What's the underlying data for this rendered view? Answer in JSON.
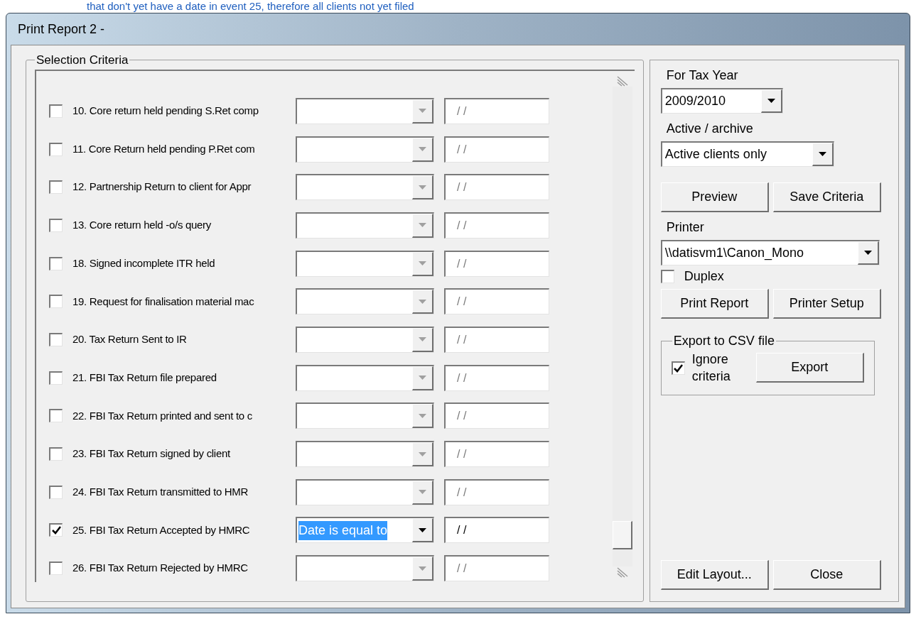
{
  "caption_above": "that don't yet have a date in event 25, therefore all clients not yet filed",
  "window": {
    "title": "Print Report 2 -"
  },
  "selection_criteria": {
    "title": "Selection Criteria",
    "rows": [
      {
        "label": "10. Core return held pending S.Ret comp",
        "checked": false,
        "condition": {
          "enabled": false
        },
        "date": "/ /"
      },
      {
        "label": "11. Core Return held pending P.Ret com",
        "checked": false,
        "condition": {
          "enabled": false
        },
        "date": "/ /"
      },
      {
        "label": "12. Partnership Return to client for Appr",
        "checked": false,
        "condition": {
          "enabled": false
        },
        "date": "/ /"
      },
      {
        "label": "13. Core return held -o/s query",
        "checked": false,
        "condition": {
          "enabled": false
        },
        "date": "/ /"
      },
      {
        "label": "18. Signed incomplete ITR held",
        "checked": false,
        "condition": {
          "enabled": false
        },
        "date": "/ /"
      },
      {
        "label": "19. Request for finalisation material mac",
        "checked": false,
        "condition": {
          "enabled": false
        },
        "date": "/ /"
      },
      {
        "label": "20. Tax Return Sent to IR",
        "checked": false,
        "condition": {
          "enabled": false
        },
        "date": "/ /"
      },
      {
        "label": "21. FBI Tax Return file prepared",
        "checked": false,
        "condition": {
          "enabled": false
        },
        "date": "/ /"
      },
      {
        "label": "22. FBI Tax Return printed and sent to c",
        "checked": false,
        "condition": {
          "enabled": false
        },
        "date": "/ /"
      },
      {
        "label": "23. FBI Tax Return signed by client",
        "checked": false,
        "condition": {
          "enabled": false
        },
        "date": "/ /"
      },
      {
        "label": "24. FBI Tax Return transmitted to HMR",
        "checked": false,
        "condition": {
          "enabled": false
        },
        "date": "/ /"
      },
      {
        "label": "25. FBI Tax Return Accepted by HMRC",
        "checked": true,
        "condition": {
          "value": "Date is equal to",
          "enabled": true
        },
        "date": "/ /"
      },
      {
        "label": "26. FBI Tax Return Rejected by HMRC",
        "checked": false,
        "condition": {
          "enabled": false
        },
        "date": "/ /"
      }
    ]
  },
  "tax_year": {
    "label": "For Tax Year",
    "value": "2009/2010"
  },
  "active_archive": {
    "label": "Active / archive",
    "value": "Active clients only"
  },
  "buttons_top": [
    "Preview",
    "Save Criteria"
  ],
  "printer": {
    "label": "Printer",
    "value": "\\\\datisvm1\\Canon_Mono"
  },
  "duplex": {
    "label": "Duplex",
    "checked": false
  },
  "buttons_print": [
    "Print Report",
    "Printer Setup"
  ],
  "export": {
    "title": "Export to CSV file",
    "ignore_label": "Ignore criteria",
    "ignore_checked": true,
    "button": "Export"
  },
  "buttons_bottom": [
    "Edit Layout...",
    "Close"
  ]
}
